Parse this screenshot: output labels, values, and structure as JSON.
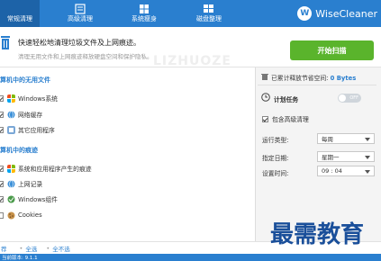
{
  "tabs": [
    {
      "label": "常规清理",
      "icon": "broom-icon"
    },
    {
      "label": "高级清理",
      "icon": "advanced-clean-icon"
    },
    {
      "label": "系统瘦身",
      "icon": "windows-icon"
    },
    {
      "label": "磁盘整理",
      "icon": "disk-icon"
    }
  ],
  "brand": {
    "name": "WiseCleaner",
    "logo_letter": "W"
  },
  "banner": {
    "heading": "快速轻松地清理垃圾文件及上网痕迹。",
    "subheading": "清理无用文件和上网痕迹释放硬盘空间和保护隐私。",
    "scan_button": "开始扫描"
  },
  "sections": [
    {
      "title": "算机中的无用文件",
      "items": [
        "Windows系统",
        "网络缓存",
        "其它应用程序"
      ]
    },
    {
      "title": "算机中的痕迹",
      "items": [
        "系统和应用程序产生的痕迹",
        "上网记录",
        "Windows组件",
        "Cookies"
      ]
    }
  ],
  "right_panel": {
    "space_saved_label": "已累计释放节省空间: ",
    "space_saved_value": "0 Bytes",
    "schedule_label": "计划任务",
    "toggle_label": "OFF",
    "include_advanced": "包含高级清理",
    "run_type_label": "运行类型:",
    "run_type_value": "每周",
    "day_label": "指定日期:",
    "day_value": "星期一",
    "time_label": "设置时间:",
    "time_value": "09 : 04"
  },
  "footer": {
    "left": "荐",
    "select_all": "全选",
    "select_none": "全不选"
  },
  "status": {
    "text": "当前版本: 9.1.1"
  },
  "watermark": {
    "faint": "LIZHUOZE",
    "main": "最需教育"
  },
  "colors": {
    "titlebar": "#2a7fcf",
    "scan_button": "#5ab42c",
    "accent": "#2a7fcf"
  }
}
